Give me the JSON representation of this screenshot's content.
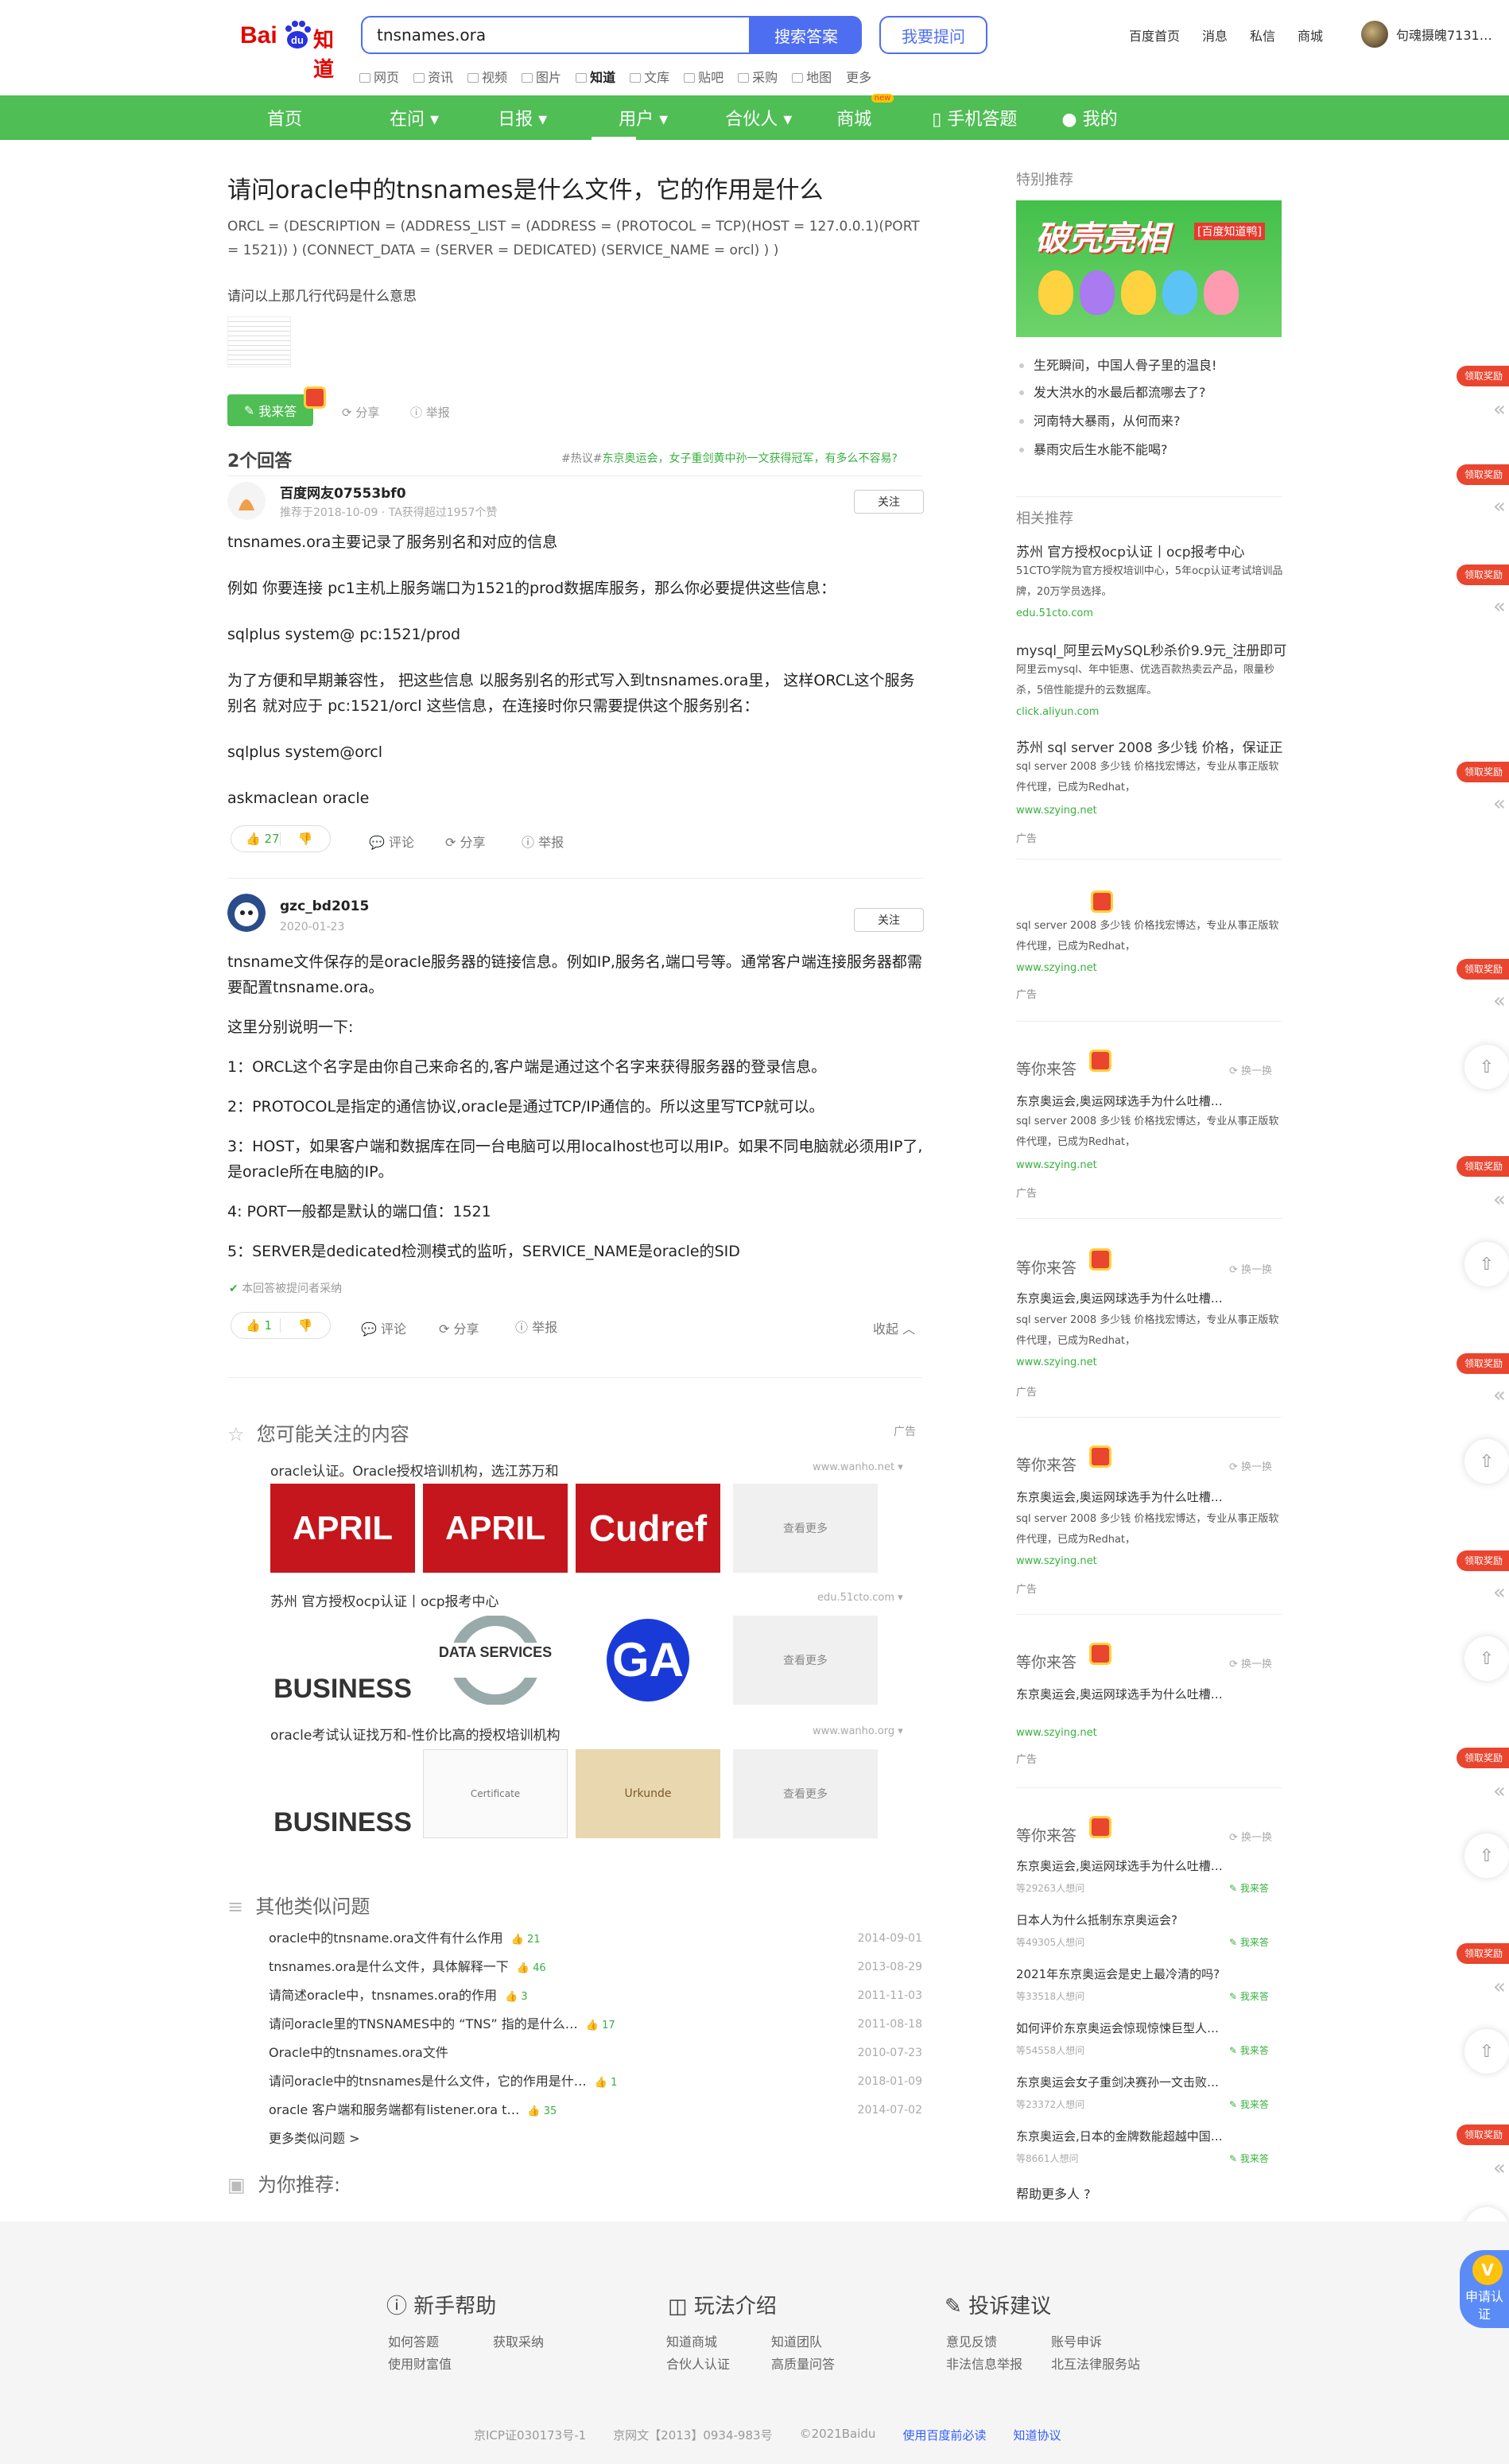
{
  "header": {
    "logo_text_bai": "Bai",
    "logo_text_du": "du",
    "logo_text_zhidao": "知道",
    "search_value": "tnsnames.ora",
    "search_button": "搜索答案",
    "ask_button": "我要提问",
    "links": [
      "百度首页",
      "消息",
      "私信",
      "商城"
    ],
    "username": "句魂摄魄7131…"
  },
  "channel_nav": {
    "items": [
      "网页",
      "资讯",
      "视频",
      "图片",
      "知道",
      "文库",
      "贴吧",
      "采购",
      "地图",
      "更多"
    ],
    "active": "知道"
  },
  "main_nav": {
    "items": [
      "首页",
      "在问",
      "日报",
      "用户",
      "合伙人",
      "商城",
      "手机答题",
      "我的"
    ],
    "new_badge": "new"
  },
  "question": {
    "title": "请问oracle中的tnsnames是什么文件，它的作用是什么",
    "body": "ORCL = (DESCRIPTION = (ADDRESS_LIST = (ADDRESS = (PROTOCOL = TCP)(HOST = 127.0.0.1)(PORT = 1521)) ) (CONNECT_DATA = (SERVER = DEDICATED) (SERVICE_NAME = orcl) ) )",
    "sub": "请问以上那几行代码是什么意思",
    "answer_button": "我来答",
    "share": "分享",
    "report": "举报"
  },
  "answers_header": {
    "count": "2个回答",
    "hot_tag": "#热议#",
    "hot_text": "东京奥运会，女子重剑黄中孙一文获得冠军，有多么不容易?"
  },
  "answer1": {
    "user": "百度网友07553bf0",
    "meta": "推荐于2018-10-09 · TA获得超过1957个赞",
    "follow": "关注",
    "paragraphs": [
      "tnsnames.ora主要记录了服务别名和对应的信息",
      "例如 你要连接 pc1主机上服务端口为1521的prod数据库服务，那么你必要提供这些信息：",
      "sqlplus system@ pc:1521/prod",
      "为了方便和早期兼容性， 把这些信息 以服务别名的形式写入到tnsnames.ora里， 这样ORCL这个服务别名 就对应于 pc:1521/orcl 这些信息，在连接时你只需要提供这个服务别名：",
      "sqlplus system@orcl",
      "askmaclean oracle"
    ],
    "likes": "27",
    "comment": "评论",
    "share": "分享",
    "report": "举报"
  },
  "answer2": {
    "user": "gzc_bd2015",
    "meta": "2020-01-23",
    "follow": "关注",
    "paragraphs": [
      "tnsname文件保存的是oracle服务器的链接信息。例如IP,服务名,端口号等。通常客户端连接服务器都需要配置tnsname.ora。",
      "这里分别说明一下:",
      "1：ORCL这个名字是由你自己来命名的,客户端是通过这个名字来获得服务器的登录信息。",
      "2：PROTOCOL是指定的通信协议,oracle是通过TCP/IP通信的。所以这里写TCP就可以。",
      "3：HOST，如果客户端和数据库在同一台电脑可以用localhost也可以用IP。如果不同电脑就必须用IP了,是oracle所在电脑的IP。",
      "4: PORT一般都是默认的端口值：1521",
      "5：SERVER是dedicated检测模式的监听，SERVICE_NAME是oracle的SID"
    ],
    "adopted": "本回答被提问者采纳",
    "likes": "1",
    "comment": "评论",
    "share": "分享",
    "report": "举报",
    "collapse": "收起"
  },
  "related_ads": {
    "title": "您可能关注的内容",
    "ad_label": "广告",
    "more": "查看更多",
    "rows": [
      {
        "title": "oracle认证。Oracle授权培训机构，选江苏万和",
        "url": "www.wanho.net",
        "tiles": [
          "APRIL",
          "APRIL",
          "Cudref"
        ]
      },
      {
        "title": "苏州 官方授权ocp认证丨ocp报考中心",
        "url": "edu.51cto.com",
        "tiles": [
          "BUSINESS",
          "DATA SERVICES",
          "GA"
        ]
      },
      {
        "title": "oracle考试认证找万和-性价比高的授权培训机构",
        "url": "www.wanho.org",
        "tiles": [
          "BUSINESS",
          "Certificate",
          "Urkunde"
        ]
      }
    ]
  },
  "similar": {
    "title": "其他类似问题",
    "rows": [
      {
        "q": "oracle中的tnsname.ora文件有什么作用",
        "likes": "21",
        "date": "2014-09-01"
      },
      {
        "q": "tnsnames.ora是什么文件，具体解释一下",
        "likes": "46",
        "date": "2013-08-29"
      },
      {
        "q": "请简述oracle中，tnsnames.ora的作用",
        "likes": "3",
        "date": "2011-11-03"
      },
      {
        "q": "请问oracle里的TNSNAMES中的 “TNS” 指的是什么…",
        "likes": "17",
        "date": "2011-08-18"
      },
      {
        "q": "Oracle中的tnsnames.ora文件",
        "likes": "",
        "date": "2010-07-23"
      },
      {
        "q": "请问oracle中的tnsnames是什么文件，它的作用是什…",
        "likes": "1",
        "date": "2018-01-09"
      },
      {
        "q": "oracle 客户端和服务端都有listener.ora t…",
        "likes": "35",
        "date": "2014-07-02"
      }
    ],
    "more": "更多类似问题 >"
  },
  "recommend": {
    "title": "为你推荐:"
  },
  "sidebar": {
    "special_title": "特别推荐",
    "promo_text": "破壳亮相",
    "promo_sub": "[百度知道鸭]",
    "bullets": [
      "生死瞬间，中国人骨子里的温良!",
      "发大洪水的水最后都流哪去了?",
      "河南特大暴雨，从何而来?",
      "暴雨灾后生水能不能喝?"
    ],
    "related_title": "相关推荐",
    "ads": [
      {
        "title": "苏州 官方授权ocp认证丨ocp报考中心",
        "desc": "51CTO学院为官方授权培训中心，5年ocp认证考试培训品牌，20万学员选择。",
        "url": "edu.51cto.com"
      },
      {
        "title": "mysql_阿里云MySQL秒杀价9.9元_注册即可",
        "desc": "阿里云mysql、年中钜惠、优选百款热卖云产品，限量秒杀，5倍性能提升的云数据库。",
        "url": "click.aliyun.com"
      },
      {
        "title": "苏州 sql server 2008 多少钱 价格，保证正",
        "desc": "sql server 2008 多少钱 价格找宏博达，专业从事正版软件代理，已成为Redhat，",
        "url": "www.szying.net"
      }
    ],
    "ad_tag": "广告",
    "wait_title": "等你来答",
    "swap": "换一换",
    "wait_q": "东京奥运会,奥运网球选手为什么吐槽…",
    "wait_desc": "sql server 2008 多少钱 价格找宏博达，专业从事正版软件代理，已成为Redhat，",
    "wait_url": "www.szying.net",
    "qa": [
      {
        "q": "东京奥运会,奥运网球选手为什么吐槽…",
        "meta": "等29263人想问"
      },
      {
        "q": "日本人为什么抵制东京奥运会?",
        "meta": "等49305人想问"
      },
      {
        "q": "2021年东京奥运会是史上最冷清的吗?",
        "meta": "等33518人想问"
      },
      {
        "q": "如何评价东京奥运会惊现惊悚巨型人…",
        "meta": "等54558人想问"
      },
      {
        "q": "东京奥运会女子重剑决赛孙一文击败…",
        "meta": "等23372人想问"
      },
      {
        "q": "东京奥运会,日本的金牌数能超越中国…",
        "meta": "等8661人想问"
      }
    ],
    "answer_link": "我来答",
    "help_more": "帮助更多人"
  },
  "side_rail": {
    "red_label": "领取奖励"
  },
  "footer": {
    "cols": [
      {
        "title": "新手帮助",
        "links": [
          "如何答题",
          "获取采纳",
          "使用财富值"
        ]
      },
      {
        "title": "玩法介绍",
        "links": [
          "知道商城",
          "知道团队",
          "合伙人认证",
          "高质量问答"
        ]
      },
      {
        "title": "投诉建议",
        "links": [
          "意见反馈",
          "账号申诉",
          "非法信息举报",
          "北互法律服务站"
        ]
      }
    ],
    "bottom": [
      "京ICP证030173号-1",
      "京网文【2013】0934-983号",
      "©2021Baidu",
      "使用百度前必读",
      "知道协议"
    ],
    "apply": "申请认证"
  },
  "colors": {
    "green": "#4fbe55",
    "blue": "#4e6ef2",
    "red": "#e9452f"
  }
}
